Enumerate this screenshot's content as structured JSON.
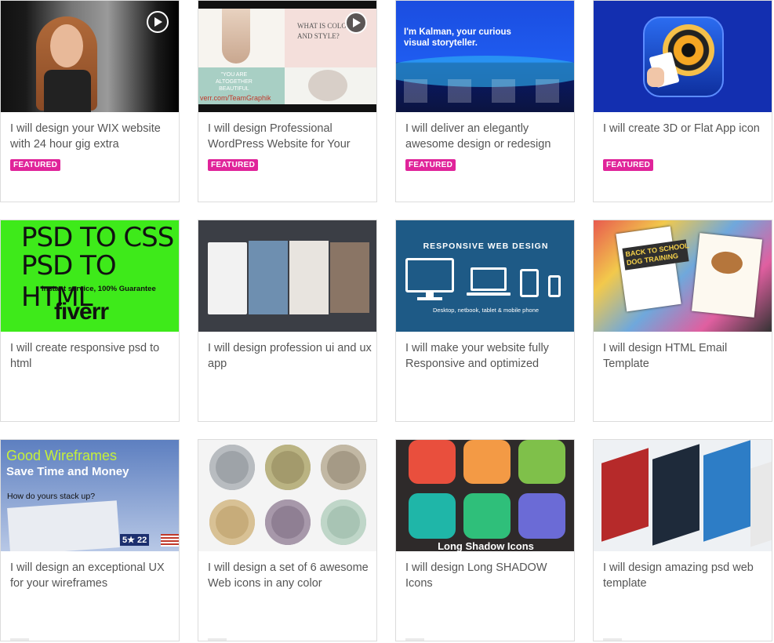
{
  "featured_label": "FEATURED",
  "cards": [
    {
      "title": "I will design your WIX website with 24 hour gig extra",
      "featured": true,
      "thumb_icon": "woman-video-thumbnail"
    },
    {
      "title": "I will design Professional WordPress Website for Your",
      "featured": true,
      "thumb_icon": "fashion-site-thumbnail",
      "thumb_text": {
        "heading": "WHAT IS COLO\nAND STYLE?",
        "quote": "\"YOU ARE\nALTOGETHER\nBEAUTIFUL",
        "url": "verr.com/TeamGraphik"
      }
    },
    {
      "title": "I will deliver an elegantly awesome design or redesign",
      "featured": true,
      "thumb_icon": "portfolio-site-thumbnail",
      "thumb_text": {
        "headline": "I'm Kalman, your curious visual storyteller."
      }
    },
    {
      "title": "I will create 3D or Flat App icon",
      "featured": true,
      "thumb_icon": "poker-app-icon-thumbnail"
    },
    {
      "title": "I will create responsive psd to html",
      "featured": false,
      "thumb_icon": "psd-to-html-thumbnail",
      "thumb_text": {
        "line1": "PSD TO CSS",
        "line2": "PSD TO HTML",
        "line3": "Instant service, 100% Guarantee",
        "brand": "fiverr"
      }
    },
    {
      "title": "I will design profession ui and ux app",
      "featured": false,
      "thumb_icon": "app-screens-thumbnail"
    },
    {
      "title": "I will make your website fully Responsive and optimized",
      "featured": false,
      "thumb_icon": "responsive-devices-thumbnail",
      "thumb_text": {
        "heading": "RESPONSIVE WEB DESIGN",
        "caption": "Desktop, netbook, tablet & mobile phone"
      }
    },
    {
      "title": "I will design HTML Email Template",
      "featured": false,
      "thumb_icon": "email-templates-thumbnail",
      "thumb_text": {
        "banner": "BACK TO SCHOOL\nDOG TRAINING"
      }
    },
    {
      "title": "I will design an exceptional UX for your wireframes",
      "featured": false,
      "thumb_icon": "wireframes-thumbnail",
      "thumb_text": {
        "line1": "Good Wireframes",
        "line2": "Save Time and Money",
        "line3": "How do yours stack up?",
        "badge": "5★ 22"
      }
    },
    {
      "title": "I will design a set of 6 awesome Web icons in any color",
      "featured": false,
      "thumb_icon": "circle-icons-thumbnail"
    },
    {
      "title": "I will design Long SHADOW Icons",
      "featured": false,
      "thumb_icon": "long-shadow-icons-thumbnail",
      "thumb_text": {
        "caption": "Long Shadow Icons"
      }
    },
    {
      "title": "I will design amazing psd web template",
      "featured": false,
      "thumb_icon": "web-templates-thumbnail"
    }
  ]
}
